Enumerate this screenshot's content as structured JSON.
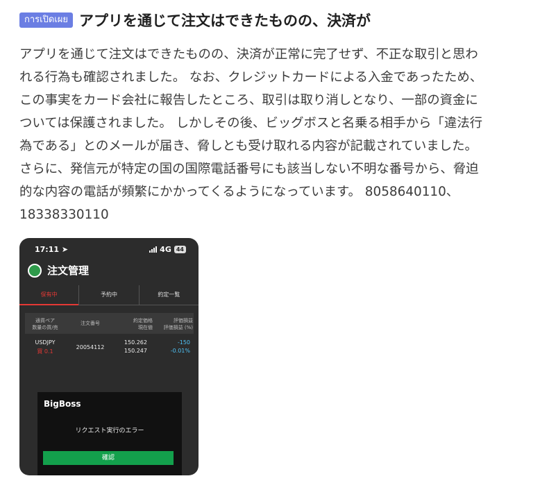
{
  "header": {
    "badge": "การเปิดเผย",
    "title": "アプリを通じて注文はできたものの、決済が"
  },
  "body": {
    "lines": [
      "アプリを通じて注文はできたものの、決済が正常に完了せず、不正な取引と思わ",
      "れる行為も確認されました。 なお、クレジットカードによる入金であったため、",
      "この事実をカード会社に報告したところ、取引は取り消しとなり、一部の資金に",
      "ついては保護されました。 しかしその後、ビッグボスと名乗る相手から「違法行",
      "為である」とのメールが届き、脅しとも受け取れる内容が記載されていました。",
      "さらに、発信元が特定の国の国際電話番号にも該当しない不明な番号から、脅迫",
      "的な内容の電話が頻繁にかかってくるようになっています。 8058640110、",
      "18338330110"
    ]
  },
  "phone": {
    "status": {
      "time": "17:11",
      "network": "4G",
      "battery": "44"
    },
    "app_title": "注文管理",
    "tabs": [
      "保有中",
      "予約中",
      "約定一覧"
    ],
    "table": {
      "headers": {
        "pair": [
          "通貨ペア",
          "数量の買/売"
        ],
        "order_no": "注文番号",
        "price": [
          "約定価格",
          "現在値"
        ],
        "pl": [
          "評価損益",
          "評価損益 (%)"
        ]
      },
      "row": {
        "pair": "USDJPY",
        "side": "買 0.1",
        "order_no": "20054112",
        "price_exec": "150.262",
        "price_now": "150.247",
        "pl": "-150",
        "pl_pct": "-0.01%"
      }
    },
    "dialog": {
      "title": "BigBoss",
      "message": "リクエスト実行のエラー",
      "confirm": "確認"
    },
    "colors": {
      "accent_red": "#e53935",
      "green_button": "#13a04c",
      "pl_blue": "#4fc3f7"
    }
  }
}
